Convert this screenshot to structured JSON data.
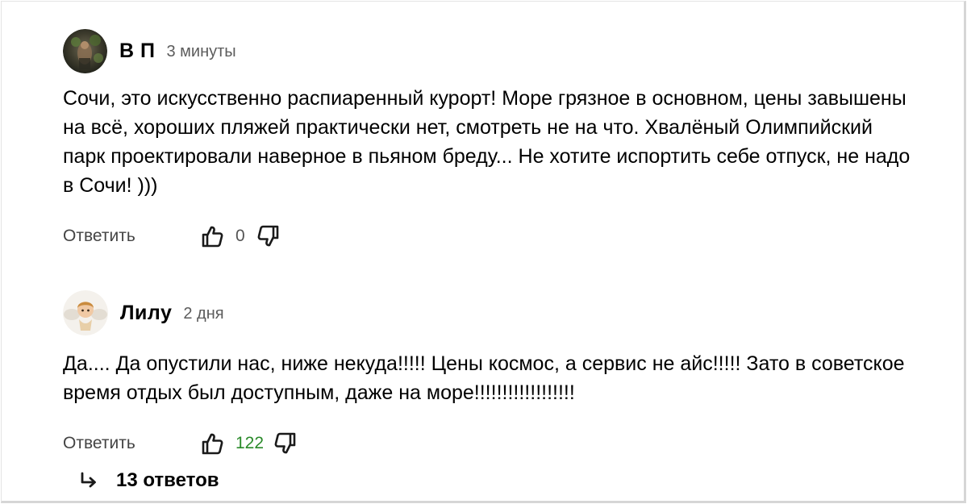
{
  "comments": [
    {
      "author": "В П",
      "time": "3 минуты",
      "text": "Сочи, это искусственно распиаренный курорт! Море грязное в основном, цены завышены на всё, хороших пляжей практически нет, смотреть не на что. Хвалёный Олимпийский парк проектировали наверное в пьяном бреду... Не хотите испортить себе отпуск, не надо в Сочи! )))",
      "reply_label": "Ответить",
      "likes": "0",
      "likes_color": "#555555"
    },
    {
      "author": "Лилу",
      "time": "2 дня",
      "text": "Да.... Да опустили нас, ниже некуда!!!!! Цены космос, а сервис не айс!!!!! Зато в советское время отдых был доступным, даже на море!!!!!!!!!!!!!!!!!!",
      "reply_label": "Ответить",
      "likes": "122",
      "likes_color": "#2a8a2a"
    }
  ],
  "replies": {
    "label": "13 ответов"
  },
  "icons": {
    "like": "thumbs-up-icon",
    "dislike": "thumbs-down-icon",
    "reply_arrow": "reply-arrow-icon"
  }
}
